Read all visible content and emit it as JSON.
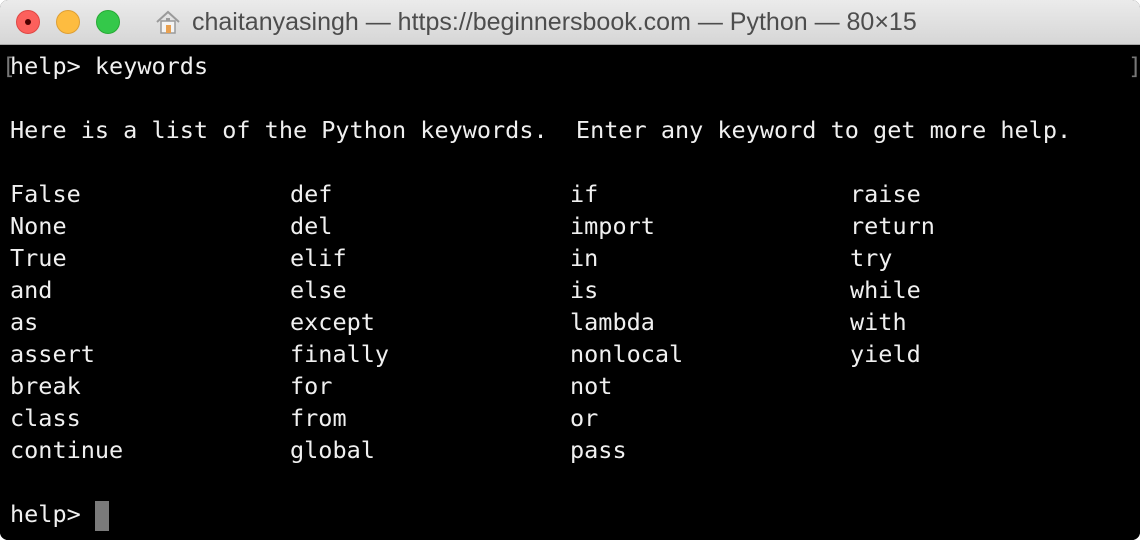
{
  "window": {
    "title": "chaitanyasingh — https://beginnersbook.com — Python — 80×15",
    "title_icon": "home-icon"
  },
  "terminal": {
    "command_prompt": "help>",
    "command": "keywords",
    "intro": "Here is a list of the Python keywords.  Enter any keyword to get more help.",
    "keyword_columns": [
      [
        "False",
        "None",
        "True",
        "and",
        "as",
        "assert",
        "break",
        "class",
        "continue"
      ],
      [
        "def",
        "del",
        "elif",
        "else",
        "except",
        "finally",
        "for",
        "from",
        "global"
      ],
      [
        "if",
        "import",
        "in",
        "is",
        "lambda",
        "nonlocal",
        "not",
        "or",
        "pass"
      ],
      [
        "raise",
        "return",
        "try",
        "while",
        "with",
        "yield"
      ]
    ],
    "final_prompt": "help>",
    "colors": {
      "background": "#000000",
      "foreground": "#f0f0f0",
      "cursor": "#7a7a7a"
    }
  }
}
